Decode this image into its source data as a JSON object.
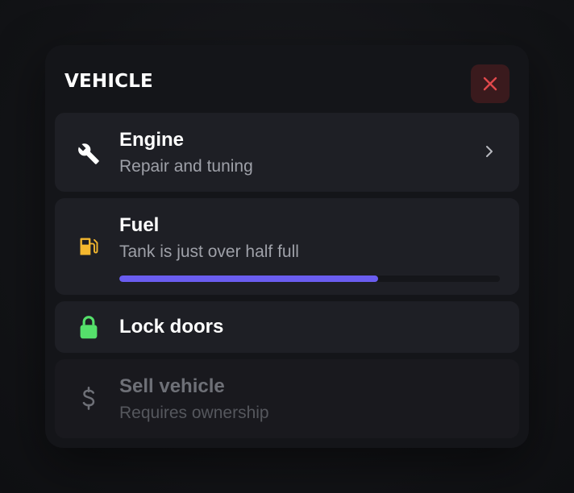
{
  "header": {
    "title": "VEHICLE",
    "close_icon": "close-icon"
  },
  "colors": {
    "accent": "#6a5df0",
    "close": "#e0484b",
    "lock": "#55e06b",
    "fuel": "#f5b82e"
  },
  "items": [
    {
      "label": "Engine",
      "subtitle": "Repair and tuning",
      "icon": "wrench-icon",
      "has_chevron": true
    },
    {
      "label": "Fuel",
      "subtitle": "Tank is just over half full",
      "icon": "fuel-pump-icon",
      "progress": 0.68
    },
    {
      "label": "Lock doors",
      "icon": "lock-icon"
    },
    {
      "label": "Sell vehicle",
      "subtitle": "Requires ownership",
      "icon": "dollar-icon",
      "disabled": true
    }
  ]
}
